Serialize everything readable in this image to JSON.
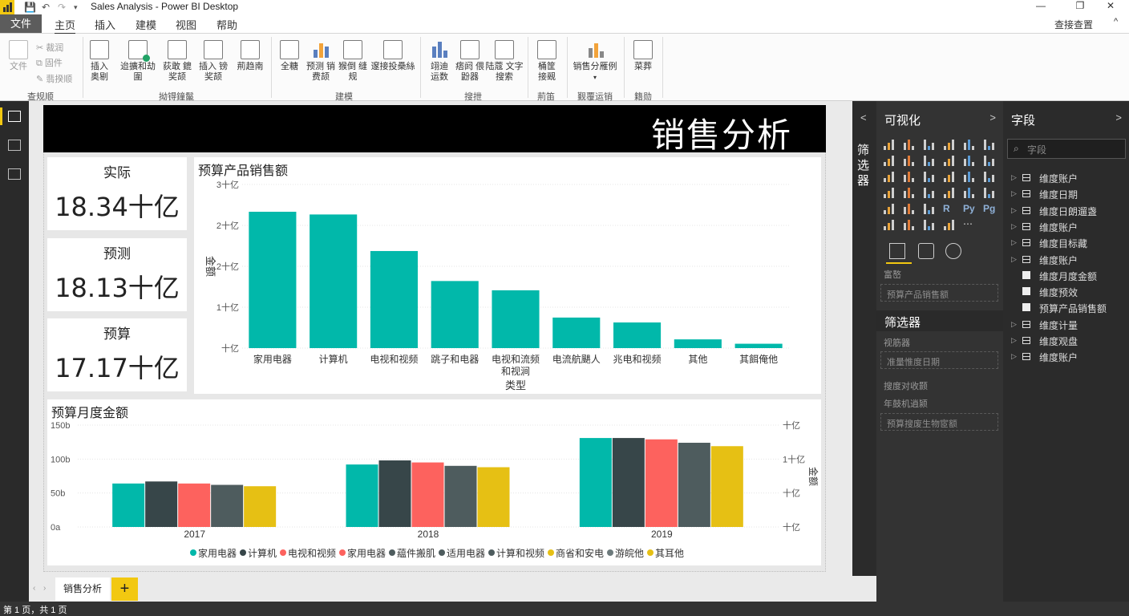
{
  "window": {
    "title": "Sales Analysis - Power BI Desktop",
    "controls": [
      "—",
      "❐",
      "✕"
    ]
  },
  "menu": {
    "file": "文件",
    "tabs": [
      "主页",
      "插入",
      "建模",
      "视图",
      "帮助"
    ],
    "help_button": "查接查置",
    "collapse": "^"
  },
  "ribbon": {
    "clipboard": {
      "paste": "文件",
      "cut": "裁润",
      "copy": "固件",
      "format_painter": "翡揆顺",
      "group": "查规顺"
    },
    "data": {
      "buttons": [
        "插入 奥剔",
        "迨擴和劫圍",
        "荻敢 鎞奖颉",
        "插入 镑奖颉",
        "荊趋南"
      ],
      "group": "拗锝鐘鬣"
    },
    "insert": {
      "buttons": [
        "全糖",
        "预测 销费颉",
        "猴倒 缝规"
      ],
      "extra": "邃接投櫐絲",
      "group": "建模"
    },
    "calc": {
      "buttons": [
        "翊迪 运数",
        "痞阏 偎鼢器",
        "陆蔻 文字搜索"
      ],
      "group": "搜抴"
    },
    "share": {
      "button": "桶筐 接觋",
      "group": "荊笛"
    },
    "publish": {
      "button": "销售分雁例",
      "group": "觐覆运销"
    },
    "view": {
      "button": "菜葬",
      "group": "籍勋"
    }
  },
  "report": {
    "banner_title": "销售分析",
    "cards": [
      {
        "label": "实际",
        "value": "18.34十亿"
      },
      {
        "label": "预测",
        "value": "18.13十亿"
      },
      {
        "label": "预算",
        "value": "17.17十亿"
      }
    ]
  },
  "chart_data": [
    {
      "type": "bar",
      "title": "预算产品销售额",
      "xlabel": "类型",
      "ylabel": "金额",
      "ytick_labels": [
        "3十亿",
        "2十亿",
        "2十亿",
        "1十亿",
        "十亿"
      ],
      "ylim": [
        0,
        3
      ],
      "categories": [
        "家用电器",
        "计算机",
        "电视和视频",
        "跳子和电器",
        "电视和流频 和视涧",
        "电流航颶人",
        "兆电和视频",
        "其他",
        "其餌俺他"
      ],
      "values": [
        2.5,
        2.45,
        1.78,
        1.23,
        1.06,
        0.56,
        0.47,
        0.16,
        0.08
      ],
      "color": "#01b8aa",
      "grid": true
    },
    {
      "type": "bar",
      "title": "预算月度金额",
      "ylabel_right": "金额",
      "categories": [
        "2017",
        "2018",
        "2019"
      ],
      "ytick_labels": [
        "150b",
        "100b",
        "50b",
        "0a"
      ],
      "ytick_labels_right": [
        "十亿",
        "1十亿",
        "十亿",
        "十亿"
      ],
      "ylim": [
        0,
        150
      ],
      "grid": true,
      "series": [
        {
          "values": [
            64,
            92,
            131
          ],
          "color": "#01b8aa"
        },
        {
          "values": [
            67,
            98,
            131
          ],
          "color": "#374649"
        },
        {
          "values": [
            64,
            95,
            129
          ],
          "color": "#fd625e"
        },
        {
          "values": [
            62,
            90,
            124
          ],
          "color": "#4e5c5e"
        },
        {
          "values": [
            60,
            88,
            119
          ],
          "color": "#e6c014"
        }
      ],
      "legend": {
        "position": "bottom",
        "items": [
          {
            "text": "家用电器",
            "color": "#01b8aa"
          },
          {
            "text": "计算机",
            "color": "#374649"
          },
          {
            "text": "电视和视频",
            "color": "#fd625e"
          },
          {
            "text": "家用电器",
            "color": "#fd625e"
          },
          {
            "text": "藴件搬肌",
            "color": "#4e5c5e"
          },
          {
            "text": "适用电器",
            "color": "#4e5c5e"
          },
          {
            "text": "计算和视频",
            "color": "#4e5c5e"
          },
          {
            "text": "商省和安电",
            "color": "#e6c014"
          },
          {
            "text": "游皖他",
            "color": "#6d7a7c"
          },
          {
            "text": "其耳他",
            "color": "#e6c014"
          }
        ]
      }
    }
  ],
  "filters_pane": {
    "label": "筛选器",
    "arrow": "<"
  },
  "viz_pane": {
    "title": "可视化",
    "arrow": ">",
    "values_label": "富嶅",
    "values_field": "预算产品销售额",
    "filters_title": "筛选器",
    "visual_filters_label": "视筋器",
    "visual_filter_field": "准量惟度日期",
    "page_filters_label": "搜度对收颢",
    "report_filters_label": "年鼓机逍颍",
    "report_filter_field": "预算搜废生物宧额",
    "more": "⋯"
  },
  "fields_pane": {
    "title": "字段",
    "arrow": ">",
    "search_placeholder": "字段",
    "items": [
      {
        "name": "维度账户",
        "kind": "table"
      },
      {
        "name": "维度日期",
        "kind": "table"
      },
      {
        "name": "维度日朗遛盏",
        "kind": "table"
      },
      {
        "name": "维度账户",
        "kind": "table"
      },
      {
        "name": "维度目标藏",
        "kind": "table"
      },
      {
        "name": "维度账户",
        "kind": "table"
      },
      {
        "name": "维度月度金额",
        "kind": "field"
      },
      {
        "name": "维度预效",
        "kind": "field"
      },
      {
        "name": "预算产品销售额",
        "kind": "field"
      },
      {
        "name": "维度计量",
        "kind": "table"
      },
      {
        "name": "维度观盘",
        "kind": "table"
      },
      {
        "name": "维度账户",
        "kind": "table"
      }
    ]
  },
  "pages": {
    "tabs": [
      "销售分析"
    ],
    "add": "+"
  },
  "status": {
    "text": "第 1 页，共 1 页"
  }
}
